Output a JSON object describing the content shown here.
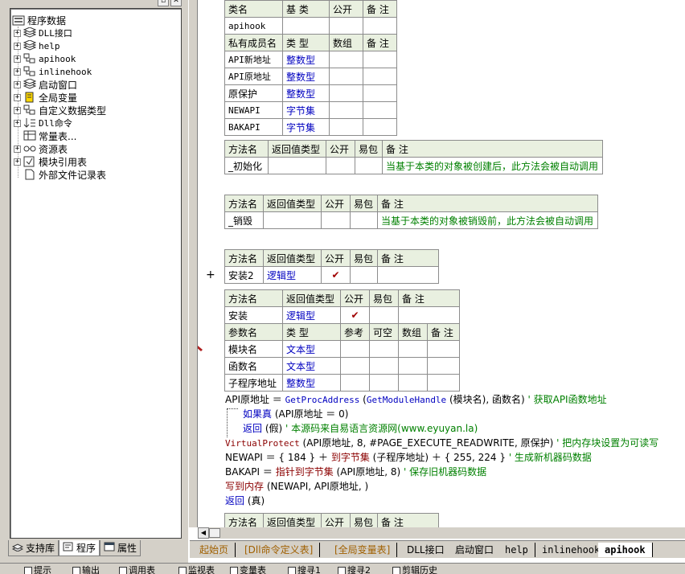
{
  "tree": {
    "root": "程序数据",
    "items": [
      {
        "label": "DLL接口",
        "icon": "book-stack-icon",
        "expandable": true
      },
      {
        "label": "help",
        "icon": "book-stack-icon",
        "expandable": true
      },
      {
        "label": "apihook",
        "icon": "class-module-icon",
        "expandable": true
      },
      {
        "label": "inlinehook",
        "icon": "class-module-icon",
        "expandable": true
      },
      {
        "label": "启动窗口",
        "icon": "book-stack-icon",
        "expandable": true
      },
      {
        "label": "全局变量",
        "icon": "global-var-icon",
        "expandable": true
      },
      {
        "label": "自定义数据类型",
        "icon": "class-module-icon",
        "expandable": true
      },
      {
        "label": "Dll命令",
        "icon": "dll-cmd-icon",
        "expandable": true
      },
      {
        "label": "常量表...",
        "icon": "const-table-icon",
        "expandable": false
      },
      {
        "label": "资源表",
        "icon": "resource-icon",
        "expandable": true
      },
      {
        "label": "模块引用表",
        "icon": "module-ref-icon",
        "expandable": true
      },
      {
        "label": "外部文件记录表",
        "icon": "file-record-icon",
        "expandable": false
      }
    ]
  },
  "left_tabs": [
    "支持库",
    "程序",
    "属性"
  ],
  "class_table": {
    "head": [
      "类名",
      "基 类",
      "公开",
      "备 注"
    ],
    "row": [
      "apihook",
      "",
      "",
      ""
    ],
    "member_head": [
      "私有成员名",
      "类 型",
      "数组",
      "备 注"
    ],
    "members": [
      [
        "API新地址",
        "整数型"
      ],
      [
        "API原地址",
        "整数型"
      ],
      [
        "原保护",
        "整数型"
      ],
      [
        "NEWAPI",
        "字节集"
      ],
      [
        "BAKAPI",
        "字节集"
      ]
    ]
  },
  "method_head": [
    "方法名",
    "返回值类型",
    "公开",
    "易包",
    "备 注"
  ],
  "method_init": {
    "name": "_初始化",
    "comment": "当基于本类的对象被创建后，此方法会被自动调用"
  },
  "method_destroy": {
    "name": "_销毁",
    "comment": "当基于本类的对象被销毁前，此方法会被自动调用"
  },
  "method_install2": {
    "name": "安装2",
    "ret": "逻辑型",
    "public": "✔"
  },
  "method_install": {
    "name": "安装",
    "ret": "逻辑型",
    "public": "✔"
  },
  "param_head": [
    "参数名",
    "类 型",
    "参考",
    "可空",
    "数组",
    "备 注"
  ],
  "params": [
    [
      "模块名",
      "文本型"
    ],
    [
      "函数名",
      "文本型"
    ],
    [
      "子程序地址",
      "整数型"
    ]
  ],
  "code": {
    "l1_a": "API原地址 ＝ ",
    "l1_fn": "GetProcAddress",
    "l1_b": " (",
    "l1_fn2": "GetModuleHandle",
    "l1_c": " (模块名), 函数名)",
    "l1_cm": " ' 获取API函数地址",
    "l2_kw": "如果真",
    "l2_b": " (API原地址 ＝ 0)",
    "l3_kw": "返回",
    "l3_b": " (假)",
    "l3_cm": " ' 本源码来自易语言资源网(www.eyuyan.la)",
    "l4_fn": "VirtualProtect",
    "l4_b": " (API原地址, 8, #PAGE_EXECUTE_READWRITE, 原保护)",
    "l4_cm": " ' 把内存块设置为可读写",
    "l5_a": "NEWAPI ＝ { 184 } ＋ ",
    "l5_fn": "到字节集",
    "l5_b": " (子程序地址) ＋ { 255, 224 }",
    "l5_cm": " ' 生成新机器码数据",
    "l6_a": "BAKAPI ＝ ",
    "l6_fn": "指针到字节集",
    "l6_b": " (API原地址, 8)",
    "l6_cm": " ' 保存旧机器码数据",
    "l7_fn": "写到内存",
    "l7_b": " (NEWAPI, API原地址, )",
    "l8_kw": "返回",
    "l8_b": " (真)"
  },
  "plus": "+",
  "doc_tabs": [
    "起始页",
    "[Dll命令定义表]",
    "[全局变量表]",
    "DLL接口",
    "启动窗口",
    "help",
    "inlinehook",
    "apihook"
  ],
  "bottom_bar": [
    "提示",
    "输出",
    "调用表",
    "监视表",
    "变量表",
    "搜寻1",
    "搜寻2",
    "剪辑历史"
  ]
}
